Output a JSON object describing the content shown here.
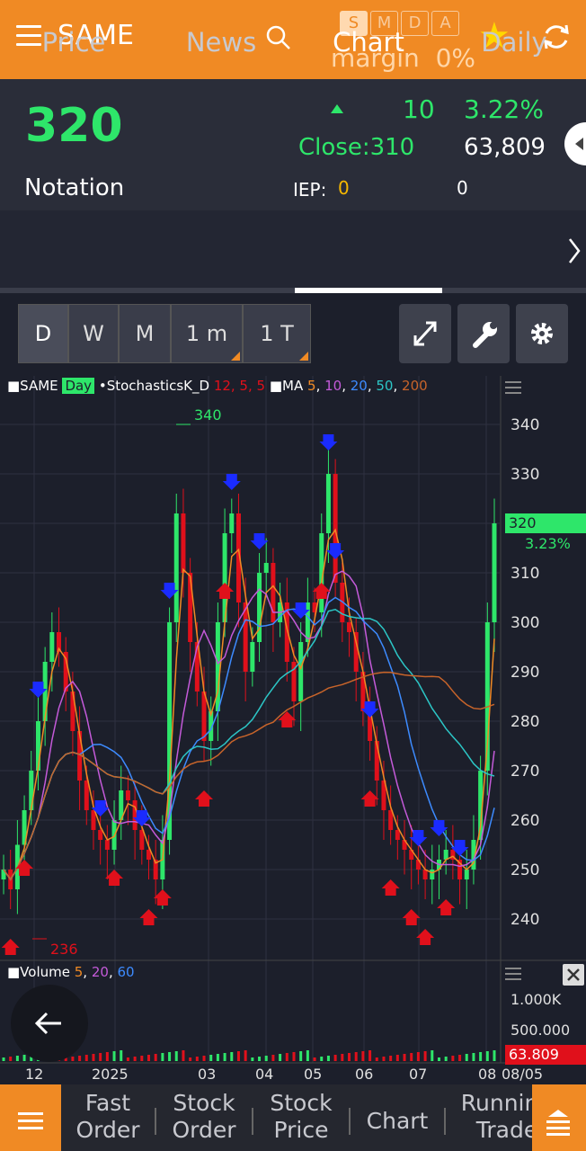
{
  "header": {
    "symbol": "SAME",
    "modes": [
      "S",
      "M",
      "D",
      "A"
    ],
    "active_mode": "S",
    "margin_label": "margin",
    "margin_value": "0%",
    "icons": [
      "menu-icon",
      "search-icon",
      "star-icon",
      "refresh-icon"
    ]
  },
  "quote": {
    "price": "320",
    "name": "Notation",
    "change": "10",
    "change_pct": "3.22%",
    "close": "Close:310",
    "volume": "63,809",
    "iep_label": "IEP:",
    "iep_value": "0",
    "iep_qty": "0"
  },
  "tabs": {
    "items": [
      "Price",
      "News",
      "Chart",
      "Daily"
    ],
    "active": "Chart"
  },
  "periods": {
    "items": [
      "D",
      "W",
      "M",
      "1 m",
      "1 T"
    ],
    "active": "D"
  },
  "chart_legend": {
    "symbol": "■SAME",
    "interval": "Day",
    "stoch": "•StochasticsK_D",
    "stoch_params": "12, 5, 5",
    "ma": "■MA",
    "ma_periods": [
      "5",
      "10",
      "20",
      "50",
      "200"
    ],
    "ma_colors": [
      "#f08a24",
      "#c45ad9",
      "#3d8bff",
      "#2cc6c6",
      "#c8642a"
    ],
    "volume": "■Volume",
    "vol_periods": [
      "5",
      "20",
      "60"
    ]
  },
  "chart_labels": {
    "high": "340",
    "low": "236",
    "price_tag": "320",
    "price_pct": "3.23%",
    "vol_tag": "63.809",
    "vol_ticks": [
      "1.000K",
      "500.000"
    ]
  },
  "chart_data": {
    "type": "candlestick",
    "y_ticks": [
      "340",
      "330",
      "320",
      "310",
      "300",
      "290",
      "280",
      "270",
      "260",
      "250",
      "240"
    ],
    "ylim": [
      234,
      344
    ],
    "x_ticks": [
      "12",
      "2025",
      "03",
      "04",
      "05",
      "06",
      "07",
      "08",
      "08/05"
    ],
    "last_close": 320,
    "period_high": 340,
    "period_low": 236,
    "closes": [
      250,
      246,
      255,
      262,
      270,
      280,
      292,
      298,
      294,
      286,
      278,
      268,
      262,
      258,
      256,
      254,
      260,
      266,
      264,
      258,
      254,
      252,
      248,
      256,
      300,
      322,
      310,
      296,
      286,
      276,
      282,
      300,
      318,
      322,
      304,
      290,
      296,
      310,
      312,
      300,
      304,
      292,
      284,
      296,
      304,
      302,
      318,
      330,
      308,
      300,
      298,
      290,
      282,
      276,
      268,
      262,
      258,
      256,
      254,
      252,
      250,
      248,
      250,
      252,
      254,
      252,
      248,
      250,
      256,
      270,
      300,
      320
    ]
  },
  "bottom_nav": {
    "items": [
      "Fast\nOrder",
      "Stock\nOrder",
      "Stock\nPrice",
      "Chart",
      "Running\nTrade"
    ]
  }
}
